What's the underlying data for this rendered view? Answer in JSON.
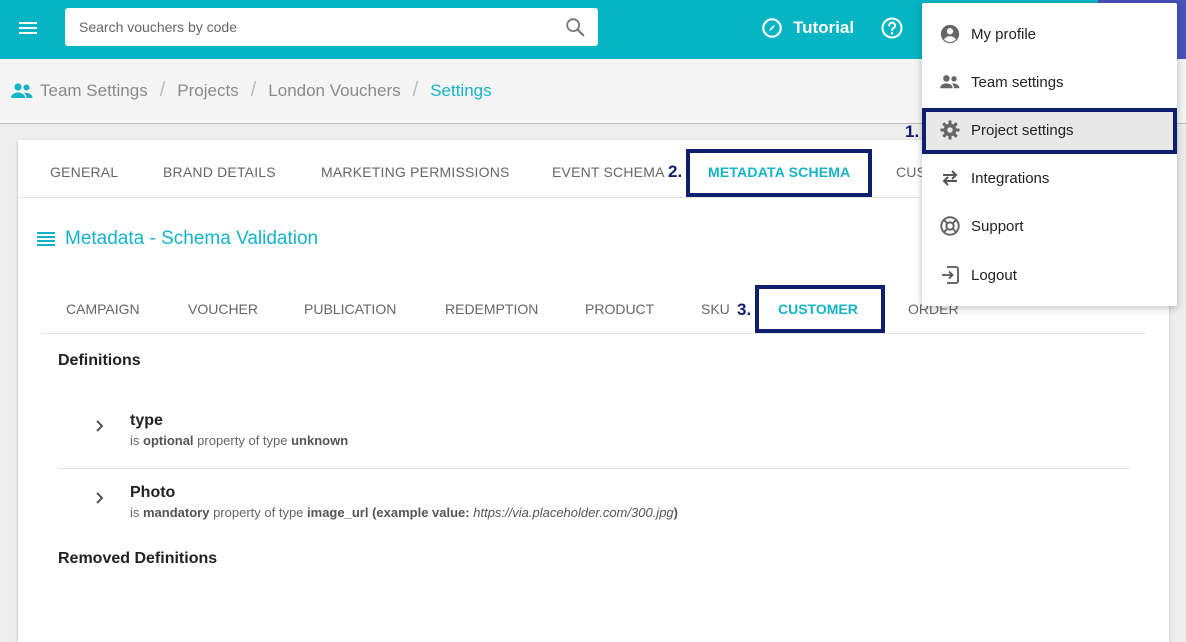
{
  "header": {
    "search_placeholder": "Search vouchers by code",
    "tutorial_label": "Tutorial"
  },
  "breadcrumb": {
    "items": [
      "Team Settings",
      "Projects",
      "London Vouchers",
      "Settings"
    ],
    "separator": "/"
  },
  "settings_tabs": {
    "items": [
      "GENERAL",
      "BRAND DETAILS",
      "MARKETING PERMISSIONS",
      "EVENT SCHEMA",
      "METADATA SCHEMA",
      "CUS"
    ],
    "active": "METADATA SCHEMA"
  },
  "section": {
    "title": "Metadata - Schema Validation"
  },
  "schema_tabs": {
    "items": [
      "CAMPAIGN",
      "VOUCHER",
      "PUBLICATION",
      "REDEMPTION",
      "PRODUCT",
      "SKU",
      "CUSTOMER",
      "ORDER"
    ],
    "active": "CUSTOMER"
  },
  "definitions": {
    "heading": "Definitions",
    "items": [
      {
        "name": "type",
        "prefix": "is ",
        "requirement": "optional",
        "middle": " property of type ",
        "type": "unknown",
        "example_label": "",
        "example_value": "",
        "example_close": ""
      },
      {
        "name": "Photo",
        "prefix": "is ",
        "requirement": "mandatory",
        "middle": " property of type ",
        "type": "image_url",
        "example_label": " (example value: ",
        "example_value": "https://via.placeholder.com/300.jpg",
        "example_close": ")"
      }
    ]
  },
  "removed_definitions": {
    "heading": "Removed Definitions"
  },
  "user_menu": {
    "items": [
      {
        "label": "My profile",
        "icon": "account-circle-icon"
      },
      {
        "label": "Team settings",
        "icon": "people-icon"
      },
      {
        "label": "Project settings",
        "icon": "gear-icon"
      },
      {
        "label": "Integrations",
        "icon": "swap-arrows-icon"
      },
      {
        "label": "Support",
        "icon": "lifebuoy-icon"
      },
      {
        "label": "Logout",
        "icon": "logout-icon"
      }
    ],
    "selected": "Project settings"
  },
  "annotations": {
    "step1": "1.",
    "step2": "2.",
    "step3": "3."
  },
  "colors": {
    "topbar": "#05b5c4",
    "accent": "#14b4c8",
    "highlight": "#0d1f6d",
    "topbar_right": "#4653b8"
  }
}
